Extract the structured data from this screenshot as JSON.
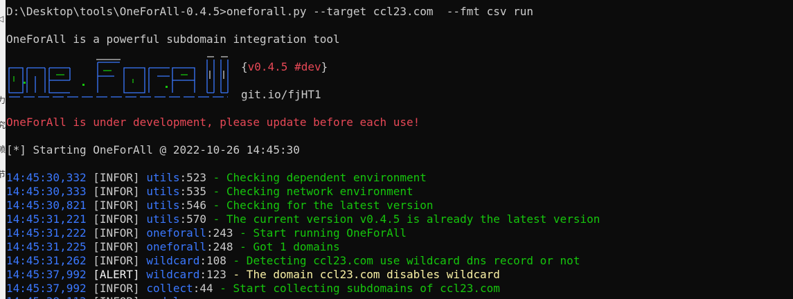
{
  "terminal": {
    "command_line": "D:\\Desktop\\tools\\OneForAll-0.4.5>oneforall.py --target ccl23.com  --fmt csv run",
    "intro": "OneForAll is a powerful subdomain integration tool",
    "version": "{v0.4.5 #dev}",
    "version_open": "{",
    "version_text": "v0.4.5 #dev",
    "version_close": "}",
    "repo": "git.io/fjHT1",
    "warning": "OneForAll is under development, please update before each use!",
    "starting": "[*] Starting OneForAll @ 2022-10-26 14:45:30",
    "logs": [
      {
        "time": "14:45:30,332",
        "level": "[INFOR]",
        "module": "utils",
        "line": ":523",
        "message": " - Checking dependent environment",
        "message_color": "green"
      },
      {
        "time": "14:45:30,333",
        "level": "[INFOR]",
        "module": "utils",
        "line": ":535",
        "message": " - Checking network environment",
        "message_color": "green"
      },
      {
        "time": "14:45:30,821",
        "level": "[INFOR]",
        "module": "utils",
        "line": ":546",
        "message": " - Checking for the latest version",
        "message_color": "green"
      },
      {
        "time": "14:45:31,221",
        "level": "[INFOR]",
        "module": "utils",
        "line": ":570",
        "message": " - The current version v0.4.5 is already the latest version",
        "message_color": "green"
      },
      {
        "time": "14:45:31,222",
        "level": "[INFOR]",
        "module": "oneforall",
        "line": ":243",
        "message": " - Start running OneForAll",
        "message_color": "green"
      },
      {
        "time": "14:45:31,225",
        "level": "[INFOR]",
        "module": "oneforall",
        "line": ":248",
        "message": " - Got 1 domains",
        "message_color": "green"
      },
      {
        "time": "14:45:31,262",
        "level": "[INFOR]",
        "module": "wildcard",
        "line": ":108",
        "message": " - Detecting ccl23.com use wildcard dns record or not",
        "message_color": "green"
      },
      {
        "time": "14:45:37,992",
        "level": "[ALERT]",
        "module": "wildcard",
        "line": ":123",
        "message": " - The domain ccl23.com disables wildcard",
        "message_color": "yellow"
      },
      {
        "time": "14:45:37,992",
        "level": "[INFOR]",
        "module": "collect",
        "line": ":44",
        "message": " - Start collecting subdomains of ccl23.com",
        "message_color": "green"
      }
    ]
  },
  "left_strip_chars": [
    "◁",
    "力",
    "究",
    "赖",
    "节"
  ],
  "colors": {
    "background": "#0c0c0c",
    "default_text": "#cccccc",
    "time": "#3b78ff",
    "module": "#3b78ff",
    "info": "#16c60c",
    "alert": "#f9f1a5",
    "warning": "#e74856"
  }
}
